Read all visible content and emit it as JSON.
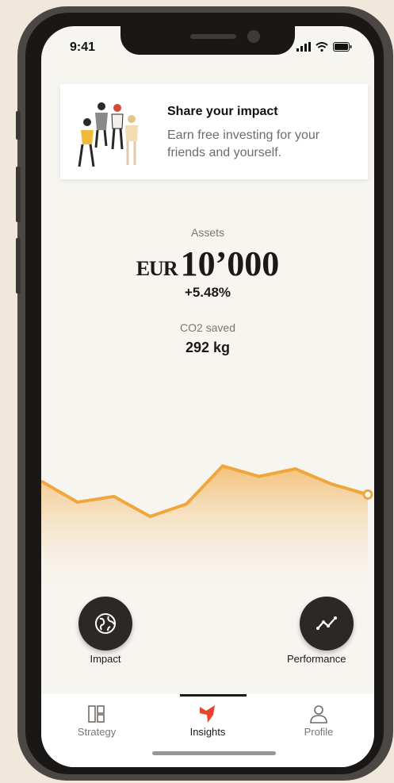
{
  "status": {
    "time": "9:41"
  },
  "promo": {
    "title": "Share your impact",
    "body": "Earn free investing for your friends and yourself."
  },
  "assets": {
    "label": "Assets",
    "currency": "EUR",
    "amount": "10’000",
    "change": "+5.48%"
  },
  "co2": {
    "label": "CO2 saved",
    "value": "292 kg"
  },
  "chart_data": {
    "type": "area",
    "title": "",
    "xlabel": "",
    "ylabel": "",
    "grid": false,
    "color": "#f0a63a",
    "values": [
      0.72,
      0.5,
      0.56,
      0.35,
      0.48,
      0.88,
      0.77,
      0.85,
      0.69,
      0.58
    ],
    "ylim": [
      0,
      1
    ],
    "last_point_marker": true
  },
  "actions": {
    "impact_label": "Impact",
    "performance_label": "Performance"
  },
  "tabs": [
    {
      "label": "Strategy",
      "icon": "strategy-icon",
      "active": false
    },
    {
      "label": "Insights",
      "icon": "insights-icon",
      "active": true
    },
    {
      "label": "Profile",
      "icon": "profile-icon",
      "active": false
    }
  ],
  "colors": {
    "accent": "#f0a63a",
    "brand_red": "#e8432f",
    "dark": "#2b2826",
    "background": "#f1e8dc"
  }
}
